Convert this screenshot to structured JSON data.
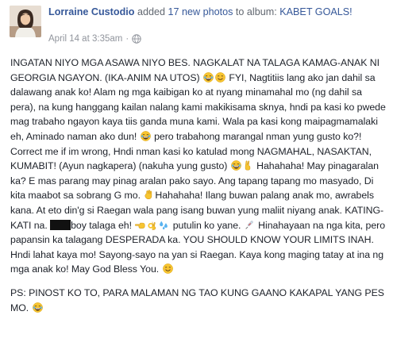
{
  "header": {
    "author": "Lorraine Custodio",
    "action_prefix": " added ",
    "photo_count_link": "17 new photos",
    "action_suffix": " to album: ",
    "album_link": "KABET GOALS!",
    "timestamp": "April 14 at 3:35am",
    "privacy_icon": "globe-icon"
  },
  "post": {
    "seg1": "INGATAN NIYO MGA ASAWA NIYO BES. NAGKALAT NA TALAGA KAMAG-ANAK NI GEORGIA NGAYON. (IKA-ANIM NA UTOS)",
    "seg2": " FYI, Nagtitiis lang ako jan dahil sa dalawang anak ko! Alam ng mga kaibigan ko at nyang minamahal mo (ng dahil sa pera), na kung hanggang kailan nalang kami makikisama sknya, hndi pa kasi ko pwede mag trabaho ngayon kaya tiis ganda muna kami. Wala pa kasi kong maipagmamalaki eh, Aminado naman ako dun!",
    "seg3": " pero trabahong marangal nman yung gusto ko?! Correct me if im wrong, Hndi nman kasi ko katulad mong NAGMAHAL, NASAKTAN, KUMABIT! (Ayun nagkapera) (nakuha yung gusto)",
    "seg4": " Hahahaha! May pinagaralan ka? E mas parang may pinag aralan pako sayo. Ang tapang tapang mo masyado, Di kita maabot sa sobrang G mo.",
    "seg5": "Hahahaha! Ilang buwan palang anak mo, awrabels kana. At eto din'g si Raegan wala pang isang buwan yung maliit niyang anak. KATING-KATI na.",
    "seg6": "boy talaga eh!",
    "seg7": " putulin ko yane.",
    "seg8": " Hinahayaan na nga kita, pero papansin ka talagang DESPERADA ka. YOU SHOULD KNOW YOUR LIMITS INAH. Hndi lahat kaya mo! Sayong-sayo na yan si Raegan. Kaya kong maging tatay at ina ng mga anak ko! May God Bless You.",
    "ps": "PS: PINOST KO TO, PARA MALAMAN NG TAO KUNG GAANO KAKAPAL YANG PES MO."
  },
  "colors": {
    "link": "#365899",
    "meta": "#90949c",
    "text": "#1d2129",
    "emoji_yellow": "#f7c531"
  }
}
